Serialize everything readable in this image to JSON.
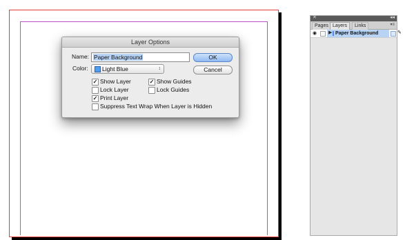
{
  "dialog": {
    "title": "Layer Options",
    "name_label": "Name:",
    "name_value": "Paper Background",
    "color_label": "Color:",
    "color_value": "Light Blue",
    "color_swatch": "#4f9df0",
    "ok_label": "OK",
    "cancel_label": "Cancel",
    "options": {
      "show_layer": {
        "label": "Show Layer",
        "checked": true
      },
      "show_guides": {
        "label": "Show Guides",
        "checked": true
      },
      "lock_layer": {
        "label": "Lock Layer",
        "checked": false
      },
      "lock_guides": {
        "label": "Lock Guides",
        "checked": false
      },
      "print_layer": {
        "label": "Print Layer",
        "checked": true
      },
      "suppress_wrap": {
        "label": "Suppress Text Wrap When Layer is Hidden",
        "checked": false
      }
    }
  },
  "panel": {
    "tabs": [
      "Pages",
      "Layers",
      "Links"
    ],
    "active_tab": "Layers",
    "layers": [
      {
        "name": "Paper Background",
        "visible": true,
        "locked": false,
        "selected": true
      }
    ]
  },
  "colors": {
    "page_border": "#e23a3a",
    "margin_guides": "#b84fc6",
    "selection": "#b8d3f4",
    "default_button": "#8fbaf2"
  }
}
